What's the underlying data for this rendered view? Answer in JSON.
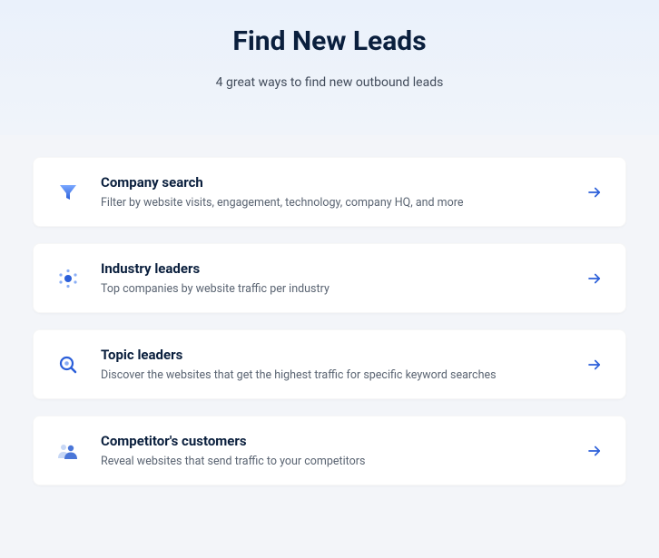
{
  "hero": {
    "title": "Find New Leads",
    "subtitle": "4 great ways to find new outbound leads"
  },
  "cards": [
    {
      "icon": "funnel-icon",
      "title": "Company search",
      "desc": "Filter by website visits, engagement, technology, company HQ, and more"
    },
    {
      "icon": "network-icon",
      "title": "Industry leaders",
      "desc": "Top companies by website traffic per industry"
    },
    {
      "icon": "magnify-icon",
      "title": "Topic leaders",
      "desc": "Discover the websites that get the highest traffic for specific keyword searches"
    },
    {
      "icon": "people-icon",
      "title": "Competitor's customers",
      "desc": "Reveal websites that send traffic to your competitors"
    }
  ],
  "colors": {
    "accent": "#2b5fd9"
  }
}
